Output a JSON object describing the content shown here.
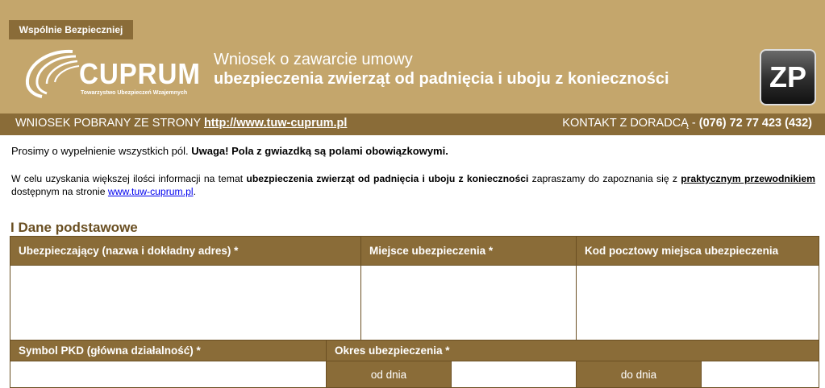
{
  "header": {
    "badge": "Wspólnie Bezpieczniej",
    "logo_name": "CUPRUM",
    "logo_sub": "Towarzystwo Ubezpieczeń Wzajemnych",
    "title_line1": "Wniosek o zawarcie umowy",
    "title_line2": "ubezpieczenia zwierząt od padnięcia i uboju z konieczności",
    "code": "ZP"
  },
  "bar": {
    "left_text": "WNIOSEK POBRANY ZE STRONY ",
    "left_url": "http://www.tuw-cuprum.pl",
    "right_text": "KONTAKT Z DORADCĄ - ",
    "right_phone": "(076) 72 77 423 (432)"
  },
  "intro": {
    "line1_normal": "Prosimy o wypełnienie wszystkich pól. ",
    "line1_bold": "Uwaga! Pola z gwiazdką są polami obowiązkowymi.",
    "p2_a": "W celu uzyskania większej ilości informacji na temat ",
    "p2_b": "ubezpieczenia zwierząt od padnięcia i uboju z konieczności",
    "p2_c": " zapraszamy do zapoznania się z ",
    "p2_d": "praktycznym przewodnikiem",
    "p2_e": " dostępnym na stronie ",
    "p2_link": "www.tuw-cuprum.pl",
    "p2_f": "."
  },
  "section_title": "I Dane podstawowe",
  "form": {
    "col_insurer": "Ubezpieczający (nazwa i dokładny adres) *",
    "col_place": "Miejsce ubezpieczenia *",
    "col_postcode": "Kod pocztowy miejsca ubezpieczenia",
    "col_pkd": "Symbol PKD (główna działalność) *",
    "col_period": "Okres ubezpieczenia *",
    "from_label": "od dnia",
    "to_label": "do dnia"
  },
  "colors": {
    "header_bg": "#c4a66c",
    "accent_dark": "#8a6c38",
    "link": "#0000ee"
  }
}
